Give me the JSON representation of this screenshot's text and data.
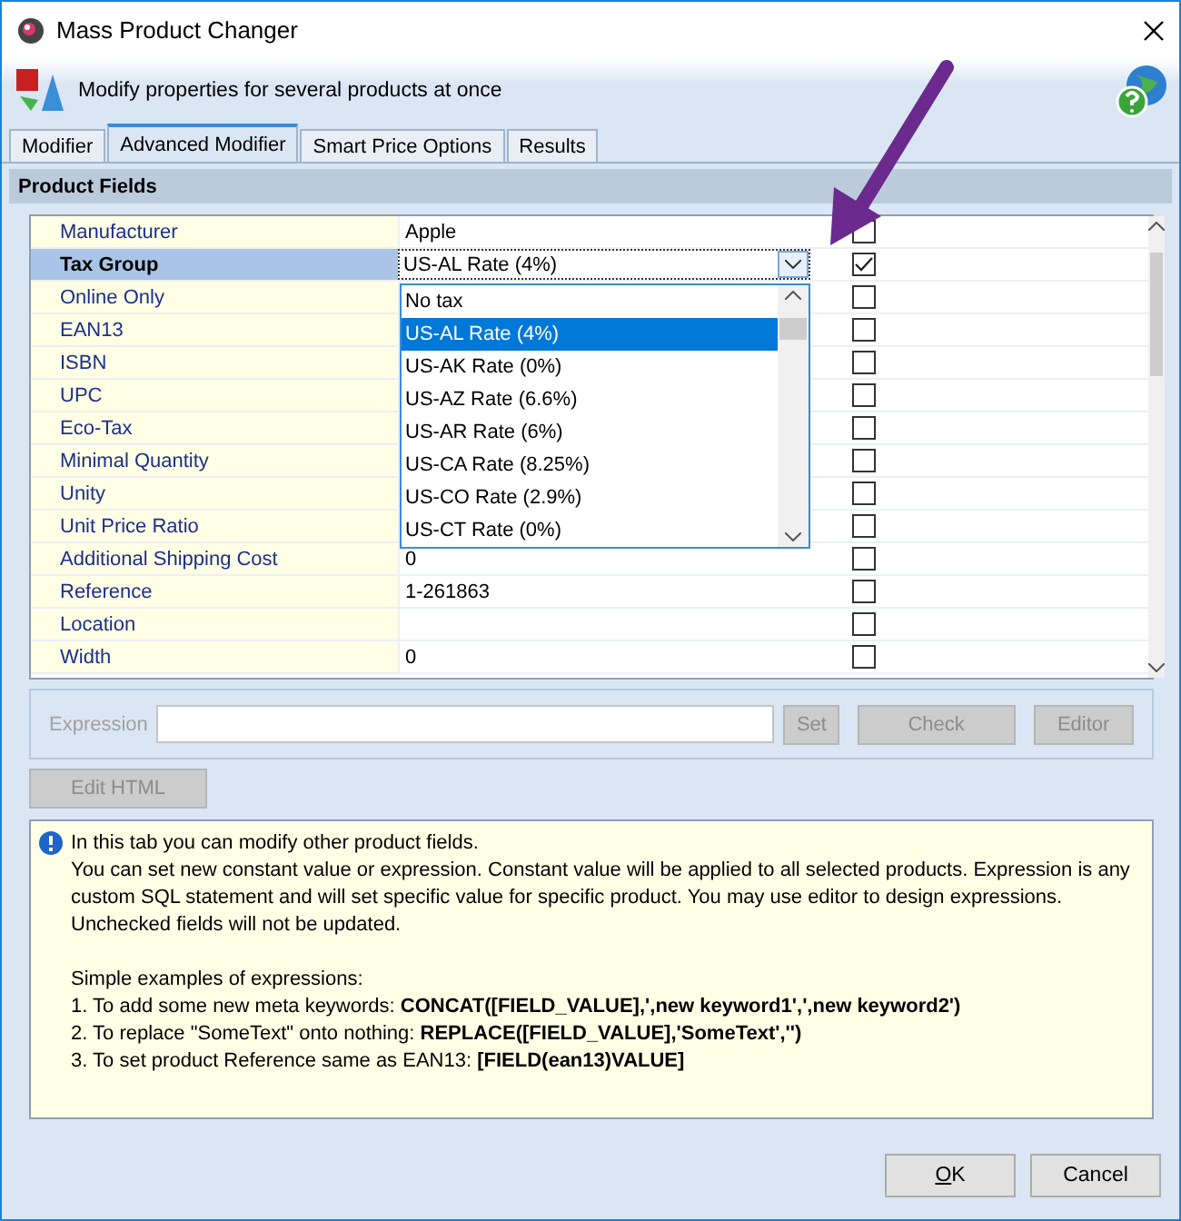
{
  "window": {
    "title": "Mass Product Changer"
  },
  "header": {
    "text": "Modify properties for several products at once"
  },
  "tabs": [
    {
      "label": "Modifier",
      "selected": false
    },
    {
      "label": "Advanced Modifier",
      "selected": true
    },
    {
      "label": "Smart Price Options",
      "selected": false
    },
    {
      "label": "Results",
      "selected": false
    }
  ],
  "panel": {
    "title": "Product Fields"
  },
  "rows": [
    {
      "label": "Manufacturer",
      "kind": "text",
      "value": "Apple",
      "checked": false,
      "selected": false
    },
    {
      "label": "Tax Group",
      "kind": "combo",
      "value": "US-AL Rate (4%)",
      "checked": true,
      "selected": true
    },
    {
      "label": "Online Only",
      "kind": "text",
      "checked": false,
      "selected": false
    },
    {
      "label": "EAN13",
      "kind": "text",
      "checked": false,
      "selected": false
    },
    {
      "label": "ISBN",
      "kind": "text",
      "checked": false,
      "selected": false
    },
    {
      "label": "UPC",
      "kind": "text",
      "checked": false,
      "selected": false
    },
    {
      "label": "Eco-Tax",
      "kind": "text",
      "checked": false,
      "selected": false
    },
    {
      "label": "Minimal Quantity",
      "kind": "text",
      "checked": false,
      "selected": false
    },
    {
      "label": "Unity",
      "kind": "text",
      "checked": false,
      "selected": false
    },
    {
      "label": "Unit Price Ratio",
      "kind": "text",
      "checked": false,
      "selected": false
    },
    {
      "label": "Additional Shipping Cost",
      "kind": "text",
      "value": "0",
      "checked": false,
      "selected": false
    },
    {
      "label": "Reference",
      "kind": "text",
      "value": "1-261863",
      "checked": false,
      "selected": false
    },
    {
      "label": "Location",
      "kind": "text",
      "checked": false,
      "selected": false
    },
    {
      "label": "Width",
      "kind": "text",
      "value": "0",
      "checked": false,
      "selected": false
    }
  ],
  "dropdown": {
    "options": [
      {
        "label": "No tax",
        "selected": false
      },
      {
        "label": "US-AL Rate (4%)",
        "selected": true
      },
      {
        "label": "US-AK Rate (0%)",
        "selected": false
      },
      {
        "label": "US-AZ Rate (6.6%)",
        "selected": false
      },
      {
        "label": "US-AR Rate (6%)",
        "selected": false
      },
      {
        "label": "US-CA Rate (8.25%)",
        "selected": false
      },
      {
        "label": "US-CO Rate (2.9%)",
        "selected": false
      },
      {
        "label": "US-CT Rate (0%)",
        "selected": false
      }
    ]
  },
  "expression": {
    "label": "Expression",
    "disabled": true,
    "buttons": [
      "Set",
      "Check",
      "Editor"
    ]
  },
  "edit_html_button": {
    "label": "Edit HTML",
    "disabled": true
  },
  "info": {
    "intro": [
      "In this tab you can modify other product fields.",
      "You can set new constant value or expression. Constant value will be applied to all selected products. Expression is any custom SQL statement and will set specific value for specific product. You may use editor to design expressions.",
      "Unchecked fields will not be updated."
    ],
    "lines": [
      "Simple examples of expressions:",
      "1. To add some new meta keywords: **CONCAT([FIELD_VALUE],',new keyword1',',new keyword2')**",
      "2. To replace \"SomeText\" onto nothing: **REPLACE([FIELD_VALUE],'SomeText','')**",
      "3. To set product Reference same as EAN13: **[FIELD(ean13)VALUE]**"
    ]
  },
  "buttons": [
    "OK",
    "Cancel"
  ]
}
